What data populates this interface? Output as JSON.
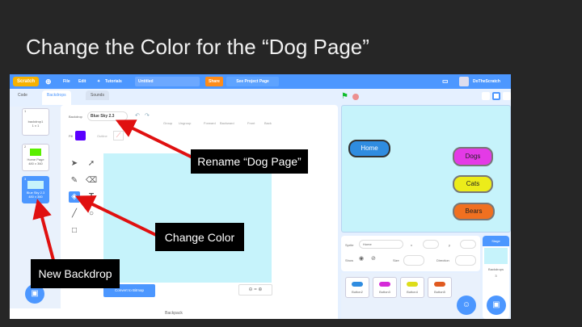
{
  "slide": {
    "title": "Change the Color for the “Dog Page”"
  },
  "menubar": {
    "logo": "Scratch",
    "file": "File",
    "edit": "Edit",
    "tutorials": "Tutorials",
    "project_title": "Untitled",
    "share": "Share",
    "see_project_page": "See Project Page",
    "username": "DoTheScratch"
  },
  "tabs": {
    "code": "Code",
    "backdrops": "Backdrops",
    "sounds": "Sounds"
  },
  "backdrops": [
    {
      "num": "1",
      "name": "backdrop1",
      "size": "1 x 1"
    },
    {
      "num": "2",
      "name": "Home Page",
      "size": "480 x 360"
    },
    {
      "num": "3",
      "name": "Blue Sky 2.3",
      "size": "480 x 360"
    }
  ],
  "paint": {
    "backdrop_label": "Backdrop",
    "backdrop_name": "Blue Sky 2.3",
    "fill_label": "Fill",
    "outline_label": "Outline",
    "fill_color": "#5a00ff",
    "group": "Group",
    "ungroup": "Ungroup",
    "forward": "Forward",
    "backward": "Backward",
    "front": "Front",
    "back": "Back",
    "convert": "Convert to Bitmap"
  },
  "stage_buttons": {
    "home": "Home",
    "dogs": "Dogs",
    "cats": "Cats",
    "bears": "Bears"
  },
  "sprite_info": {
    "sprite_label": "Sprite",
    "sprite_name": "Home",
    "x_label": "x",
    "y_label": "y",
    "show_label": "Show",
    "size_label": "Size",
    "direction_label": "Direction"
  },
  "sprites": [
    "Button2",
    "Button3",
    "Button4",
    "Button5"
  ],
  "stage_panel": {
    "label": "Stage",
    "backdrops_label": "Backdrops",
    "count": "3"
  },
  "backpack": "Backpack",
  "callouts": {
    "rename": "Rename “Dog Page”",
    "change_color": "Change Color",
    "new_backdrop": "New Backdrop"
  },
  "colors": {
    "blue": "#4c97ff",
    "arrow": "#e01010"
  }
}
